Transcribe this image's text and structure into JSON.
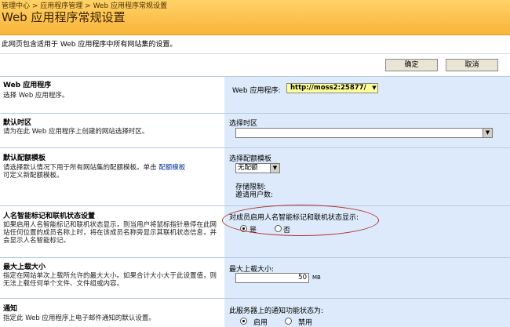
{
  "breadcrumb": {
    "c1": "管理中心",
    "sep1": " > ",
    "c2": "应用程序管理",
    "sep2": " > ",
    "c3": "Web 应用程序常规设置"
  },
  "page_title": "Web 应用程序常规设置",
  "page_description": "此网页包含适用于 Web 应用程序中所有网站集的设置。",
  "buttons": {
    "ok": "确定",
    "cancel": "取消"
  },
  "sections": {
    "webapp": {
      "title": "Web 应用程序",
      "desc": "选择 Web 应用程序。",
      "field_label": "Web 应用程序:",
      "value": "http://moss2:25877/"
    },
    "timezone": {
      "title": "默认时区",
      "desc": "请为在此 Web 应用程序上创建的网站选择时区。",
      "field_label": "选择时区",
      "value": ""
    },
    "quota": {
      "title": "默认配额模板",
      "desc_part1": "请选择默认情况下用于所有网站集的配额模板。单击 ",
      "link": "配额模板",
      "desc_part2": "可定义新配额模板。",
      "field_label": "选择配额模板",
      "value": "无配额",
      "storage_label": "存储限制:",
      "invite_label": "邀请用户数:"
    },
    "presence": {
      "title": "人名智能标记和联机状态设置",
      "desc": "如果启用人名智能标记和联机状态显示，则当用户将鼠标指针悬停在此网站任何位置的成员名称上时，将在该成员名称旁显示其联机状态信息，并会显示人名智能标记。",
      "field_label": "对成员启用人名智能标记和联机状态显示:",
      "yes": "是",
      "no": "否"
    },
    "upload": {
      "title": "最大上载大小",
      "desc": "指定在网站单次上载所允许的最大大小。如果合计大小大于此设置值，则无法上载任何单个文件、文件组或内容。",
      "field_label": "最大上载大小:",
      "value": "50",
      "unit": "MB"
    },
    "alerts": {
      "title": "通知",
      "desc": "指定此 Web 应用程序上电子邮件通知的默认设置。",
      "field_label": "此服务器上的通知功能状态为:",
      "on": "启用",
      "off": "禁用"
    }
  }
}
